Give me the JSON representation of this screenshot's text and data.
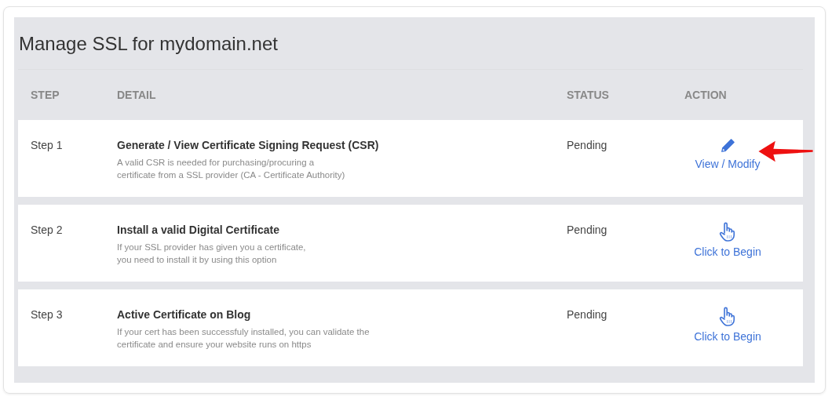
{
  "title": "Manage SSL for mydomain.net",
  "columns": [
    "STEP",
    "DETAIL",
    "STATUS",
    "ACTION"
  ],
  "rows": [
    {
      "step": "Step 1",
      "title": "Generate / View Certificate Signing Request (CSR)",
      "description": [
        "A valid CSR is needed for purchasing/procuring a",
        "certificate from a SSL provider (CA - Certificate Authority)"
      ],
      "status": "Pending",
      "action": {
        "kind": "edit",
        "label": "View / Modify"
      },
      "highlighted": true
    },
    {
      "step": "Step 2",
      "title": "Install a valid Digital Certificate",
      "description": [
        "If your SSL provider has given you a certificate,",
        "you need to install it by using this option"
      ],
      "status": "Pending",
      "action": {
        "kind": "begin",
        "label": "Click to Begin"
      },
      "highlighted": false
    },
    {
      "step": "Step 3",
      "title": "Active Certificate on Blog",
      "description": [
        "If your cert has been successfuly installed, you can validate the",
        "certificate and ensure your website runs on https"
      ],
      "status": "Pending",
      "action": {
        "kind": "begin",
        "label": "Click to Begin"
      },
      "highlighted": false
    }
  ]
}
